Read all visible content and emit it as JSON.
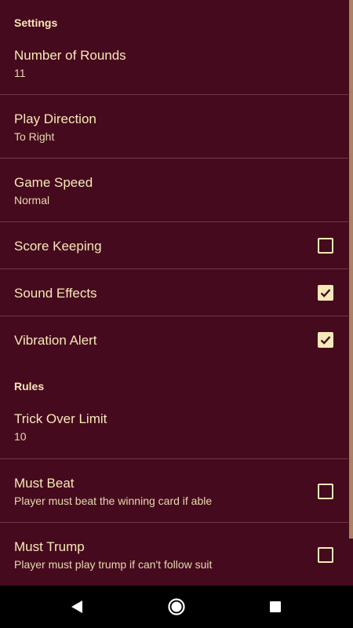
{
  "sections": {
    "settings_header": "Settings",
    "rules_header": "Rules"
  },
  "prefs": {
    "rounds": {
      "title": "Number of Rounds",
      "summary": "11"
    },
    "direction": {
      "title": "Play Direction",
      "summary": "To Right"
    },
    "speed": {
      "title": "Game Speed",
      "summary": "Normal"
    },
    "score": {
      "title": "Score Keeping",
      "checked": false
    },
    "sound": {
      "title": "Sound Effects",
      "checked": true
    },
    "vibration": {
      "title": "Vibration Alert",
      "checked": true
    },
    "trick_limit": {
      "title": "Trick Over Limit",
      "summary": "10"
    },
    "must_beat": {
      "title": "Must Beat",
      "summary": "Player must beat the winning card if able",
      "checked": false
    },
    "must_trump": {
      "title": "Must Trump",
      "summary": "Player must play trump if can't follow suit",
      "checked": false
    }
  },
  "colors": {
    "background": "#460A1E",
    "text": "#F6E9B8",
    "scrollbar": "#A98462",
    "navbar": "#000000"
  },
  "icons": {
    "checkbox_checked": "check-icon",
    "nav_back": "back-triangle-icon",
    "nav_home": "home-circle-icon",
    "nav_recents": "recents-square-icon"
  }
}
